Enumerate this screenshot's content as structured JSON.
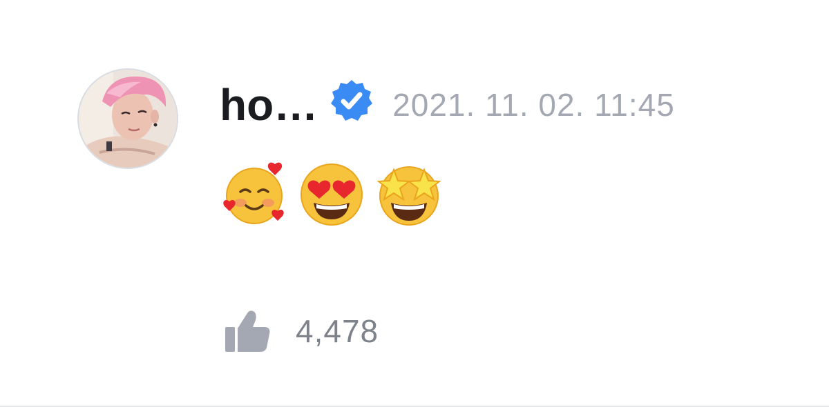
{
  "comment": {
    "author": {
      "name": "ho…",
      "avatar": "profile-photo",
      "verified": true,
      "verified_icon": "verified-badge-icon"
    },
    "timestamp": "2021. 11. 02. 11:45",
    "content": {
      "emojis": [
        "smiling-face-with-hearts",
        "heart-eyes",
        "star-struck"
      ]
    },
    "likes": {
      "icon": "thumbs-up-icon",
      "count": "4,478"
    }
  },
  "colors": {
    "username": "#1b1c1f",
    "timestamp": "#a3a8b2",
    "verified": "#3b8bf5",
    "like_icon": "#a3a8b2",
    "like_count": "#7d828b"
  }
}
